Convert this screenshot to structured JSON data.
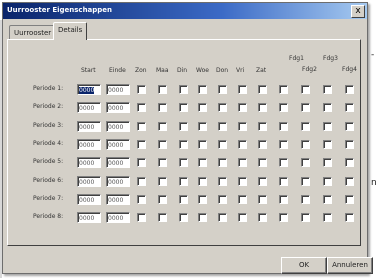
{
  "background": {
    "left_char_top": "-",
    "left_char_bottom": "n"
  },
  "dialog": {
    "title": "Uurrooster Eigenschappen",
    "close_label": "x",
    "tabs": [
      {
        "label": "Uurrooster",
        "active": false
      },
      {
        "label": "Details",
        "active": true
      }
    ],
    "columns": {
      "start": "Start",
      "end": "Einde",
      "days": [
        "Zon",
        "Maa",
        "Din",
        "Woe",
        "Don",
        "Vri",
        "Zat"
      ],
      "holidays": [
        "Fdg1",
        "Fdg2",
        "Fdg3",
        "Fdg4"
      ]
    },
    "periods": [
      {
        "label": "Periode 1:",
        "start": "0000",
        "end": "0000",
        "start_selected": true
      },
      {
        "label": "Periode 2:",
        "start": "0000",
        "end": "0000"
      },
      {
        "label": "Periode 3:",
        "start": "0000",
        "end": "0000"
      },
      {
        "label": "Periode 4:",
        "start": "0000",
        "end": "0000"
      },
      {
        "label": "Periode 5:",
        "start": "0000",
        "end": "0000"
      },
      {
        "label": "Periode 6:",
        "start": "0000",
        "end": "0000"
      },
      {
        "label": "Periode 7:",
        "start": "0000",
        "end": "0000"
      },
      {
        "label": "Periode 8:",
        "start": "0000",
        "end": "0000"
      }
    ],
    "buttons": {
      "ok": "OK",
      "cancel": "Annuleren"
    }
  }
}
